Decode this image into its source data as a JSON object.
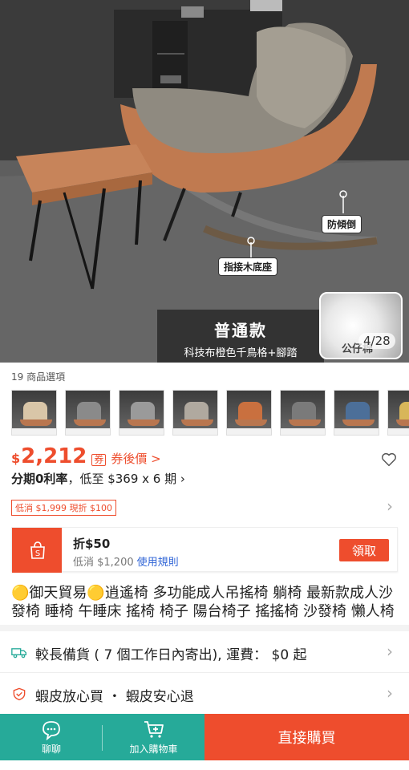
{
  "hero": {
    "callout_anti_tip": "防傾倒",
    "callout_wood_base": "指接木底座",
    "variant_name": "普通款",
    "variant_desc": "科技布橙色千鳥格+腳踏",
    "thumb_label": "公仔棉",
    "page_counter": "4/28"
  },
  "variants": {
    "count_label": "19 商品選項",
    "thumbs": [
      {
        "seat_color": "#d9c6a8"
      },
      {
        "seat_color": "#8a8a8a"
      },
      {
        "seat_color": "#9a9a9a"
      },
      {
        "seat_color": "#b0a99f"
      },
      {
        "seat_color": "#c9703f"
      },
      {
        "seat_color": "#7a7a7a"
      },
      {
        "seat_color": "#4c6f99"
      },
      {
        "seat_color": "#d8b65a"
      }
    ]
  },
  "price": {
    "currency": "$",
    "value": "2,212",
    "coupon_icon": "券",
    "after_coupon_label": "券後價 >",
    "installment_bold": "分期0利率",
    "installment_rest": "，低至 $369 x 6 期 ›",
    "discount_tag": "低消 $1,999 現折 $100"
  },
  "voucher": {
    "title": "折$50",
    "condition": "低消 $1,200",
    "rules_link": "使用規則",
    "claim_label": "領取"
  },
  "product_title": "🟡御天貿易🟡逍遙椅 多功能成人吊搖椅 躺椅 最新款成人沙發椅 睡椅 午睡床 搖椅 椅子 陽台椅子 搖搖椅 沙發椅 懶人椅",
  "shipping": {
    "icon": "truck-icon",
    "text": "較長備貨 ( 7 個工作日內寄出), 運費： $0 起"
  },
  "guarantee": {
    "icon": "shield-icon",
    "text": "蝦皮放心買 ・ 蝦皮安心退"
  },
  "bottom_bar": {
    "chat_label": "聊聊",
    "cart_label": "加入購物車",
    "buy_label": "直接購買"
  },
  "colors": {
    "brand_orange": "#ee4d2d",
    "teal": "#26aa99",
    "link_blue": "#2e63d6"
  }
}
